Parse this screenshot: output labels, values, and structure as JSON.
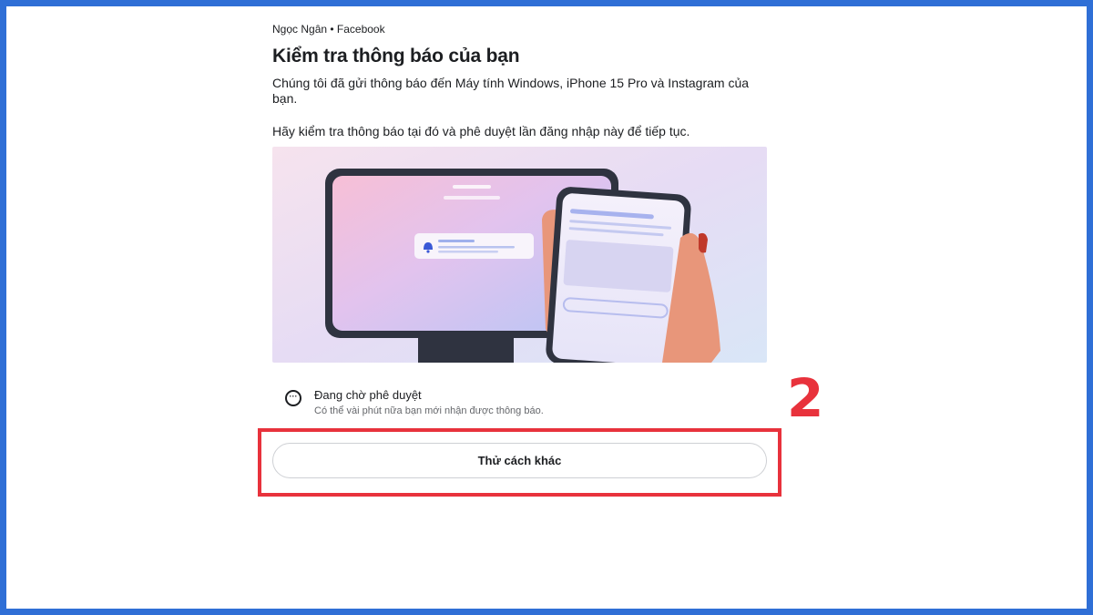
{
  "header": {
    "account_line": "Ngọc Ngân • Facebook",
    "title": "Kiểm tra thông báo của bạn"
  },
  "body": {
    "description": "Chúng tôi đã gửi thông báo đến Máy tính Windows, iPhone 15 Pro và Instagram của bạn.",
    "instruction": "Hãy kiểm tra thông báo tại đó và phê duyệt lần đăng nhập này để tiếp tục."
  },
  "status": {
    "icon": "more-horizontal-circle-icon",
    "title": "Đang chờ phê duyệt",
    "subtitle": "Có thể vài phút nữa bạn mới nhận được thông báo."
  },
  "actions": {
    "try_another_way": "Thử cách khác"
  },
  "annotation": {
    "step_number": "2",
    "color": "#e8323c"
  },
  "colors": {
    "border_frame": "#2f6fd6",
    "text": "#1c1e21",
    "secondary_text": "#65676b"
  }
}
